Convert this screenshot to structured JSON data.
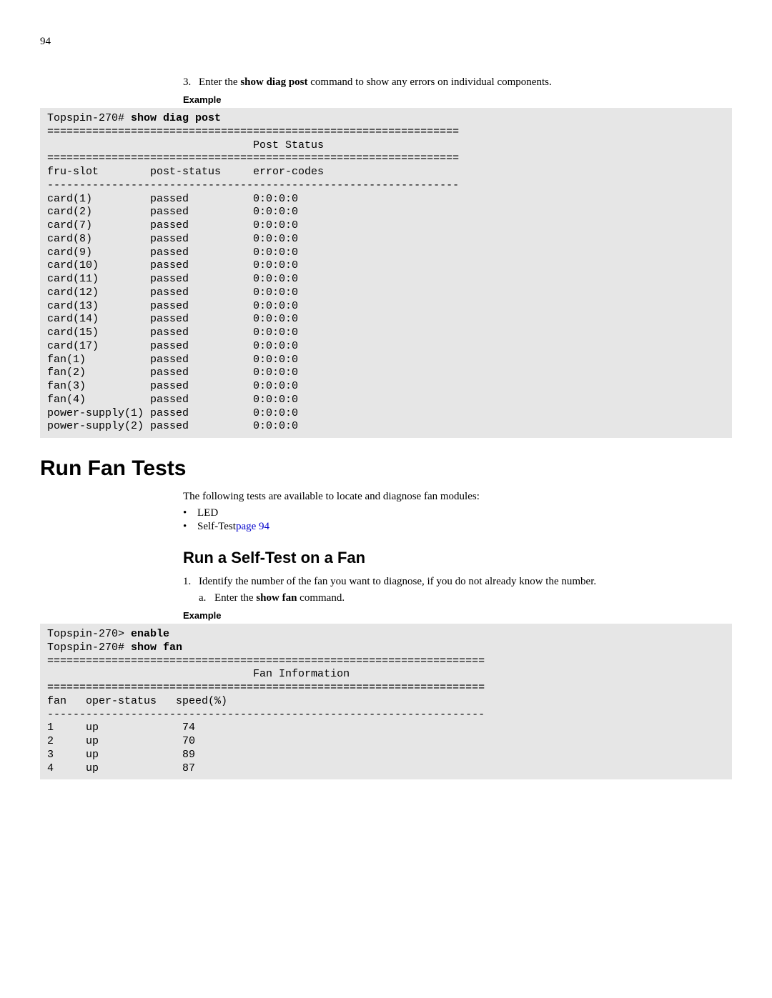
{
  "page_number": "94",
  "step3": {
    "num": "3.",
    "pre": "Enter the ",
    "cmd": "show diag post",
    "post": " command to show any errors on individual components."
  },
  "example_label": "Example",
  "code1": {
    "prompt": "Topspin-270# ",
    "cmd": "show diag post",
    "divider": "================================================================",
    "title": "                                Post Status",
    "headers_line": "fru-slot        post-status     error-codes",
    "dashes": "----------------------------------------------------------------",
    "rows": [
      "card(1)         passed          0:0:0:0",
      "card(2)         passed          0:0:0:0",
      "card(7)         passed          0:0:0:0",
      "card(8)         passed          0:0:0:0",
      "card(9)         passed          0:0:0:0",
      "card(10)        passed          0:0:0:0",
      "card(11)        passed          0:0:0:0",
      "card(12)        passed          0:0:0:0",
      "card(13)        passed          0:0:0:0",
      "card(14)        passed          0:0:0:0",
      "card(15)        passed          0:0:0:0",
      "card(17)        passed          0:0:0:0",
      "fan(1)          passed          0:0:0:0",
      "fan(2)          passed          0:0:0:0",
      "fan(3)          passed          0:0:0:0",
      "fan(4)          passed          0:0:0:0",
      "power-supply(1) passed          0:0:0:0",
      "power-supply(2) passed          0:0:0:0"
    ]
  },
  "h1": "Run Fan Tests",
  "intro": "The following tests are available to locate and diagnose fan modules:",
  "bullets": {
    "b1": "LED",
    "b2_pre": "Self-Test ",
    "b2_link": "page 94"
  },
  "h2": "Run a Self-Test on a Fan",
  "step1": {
    "num": "1.",
    "text": "Identify the number of the fan you want to diagnose, if you do not already know the number."
  },
  "substep_a": {
    "num": "a.",
    "pre": "Enter the ",
    "cmd": "show fan",
    "post": " command."
  },
  "code2": {
    "prompt1": "Topspin-270> ",
    "cmd1": "enable",
    "prompt2": "Topspin-270# ",
    "cmd2": "show fan",
    "divider": "====================================================================",
    "title": "                                Fan Information",
    "headers_line": "fan   oper-status   speed(%)",
    "dashes": "--------------------------------------------------------------------",
    "rows": [
      "1     up             74",
      "2     up             70",
      "3     up             89",
      "4     up             87"
    ]
  }
}
